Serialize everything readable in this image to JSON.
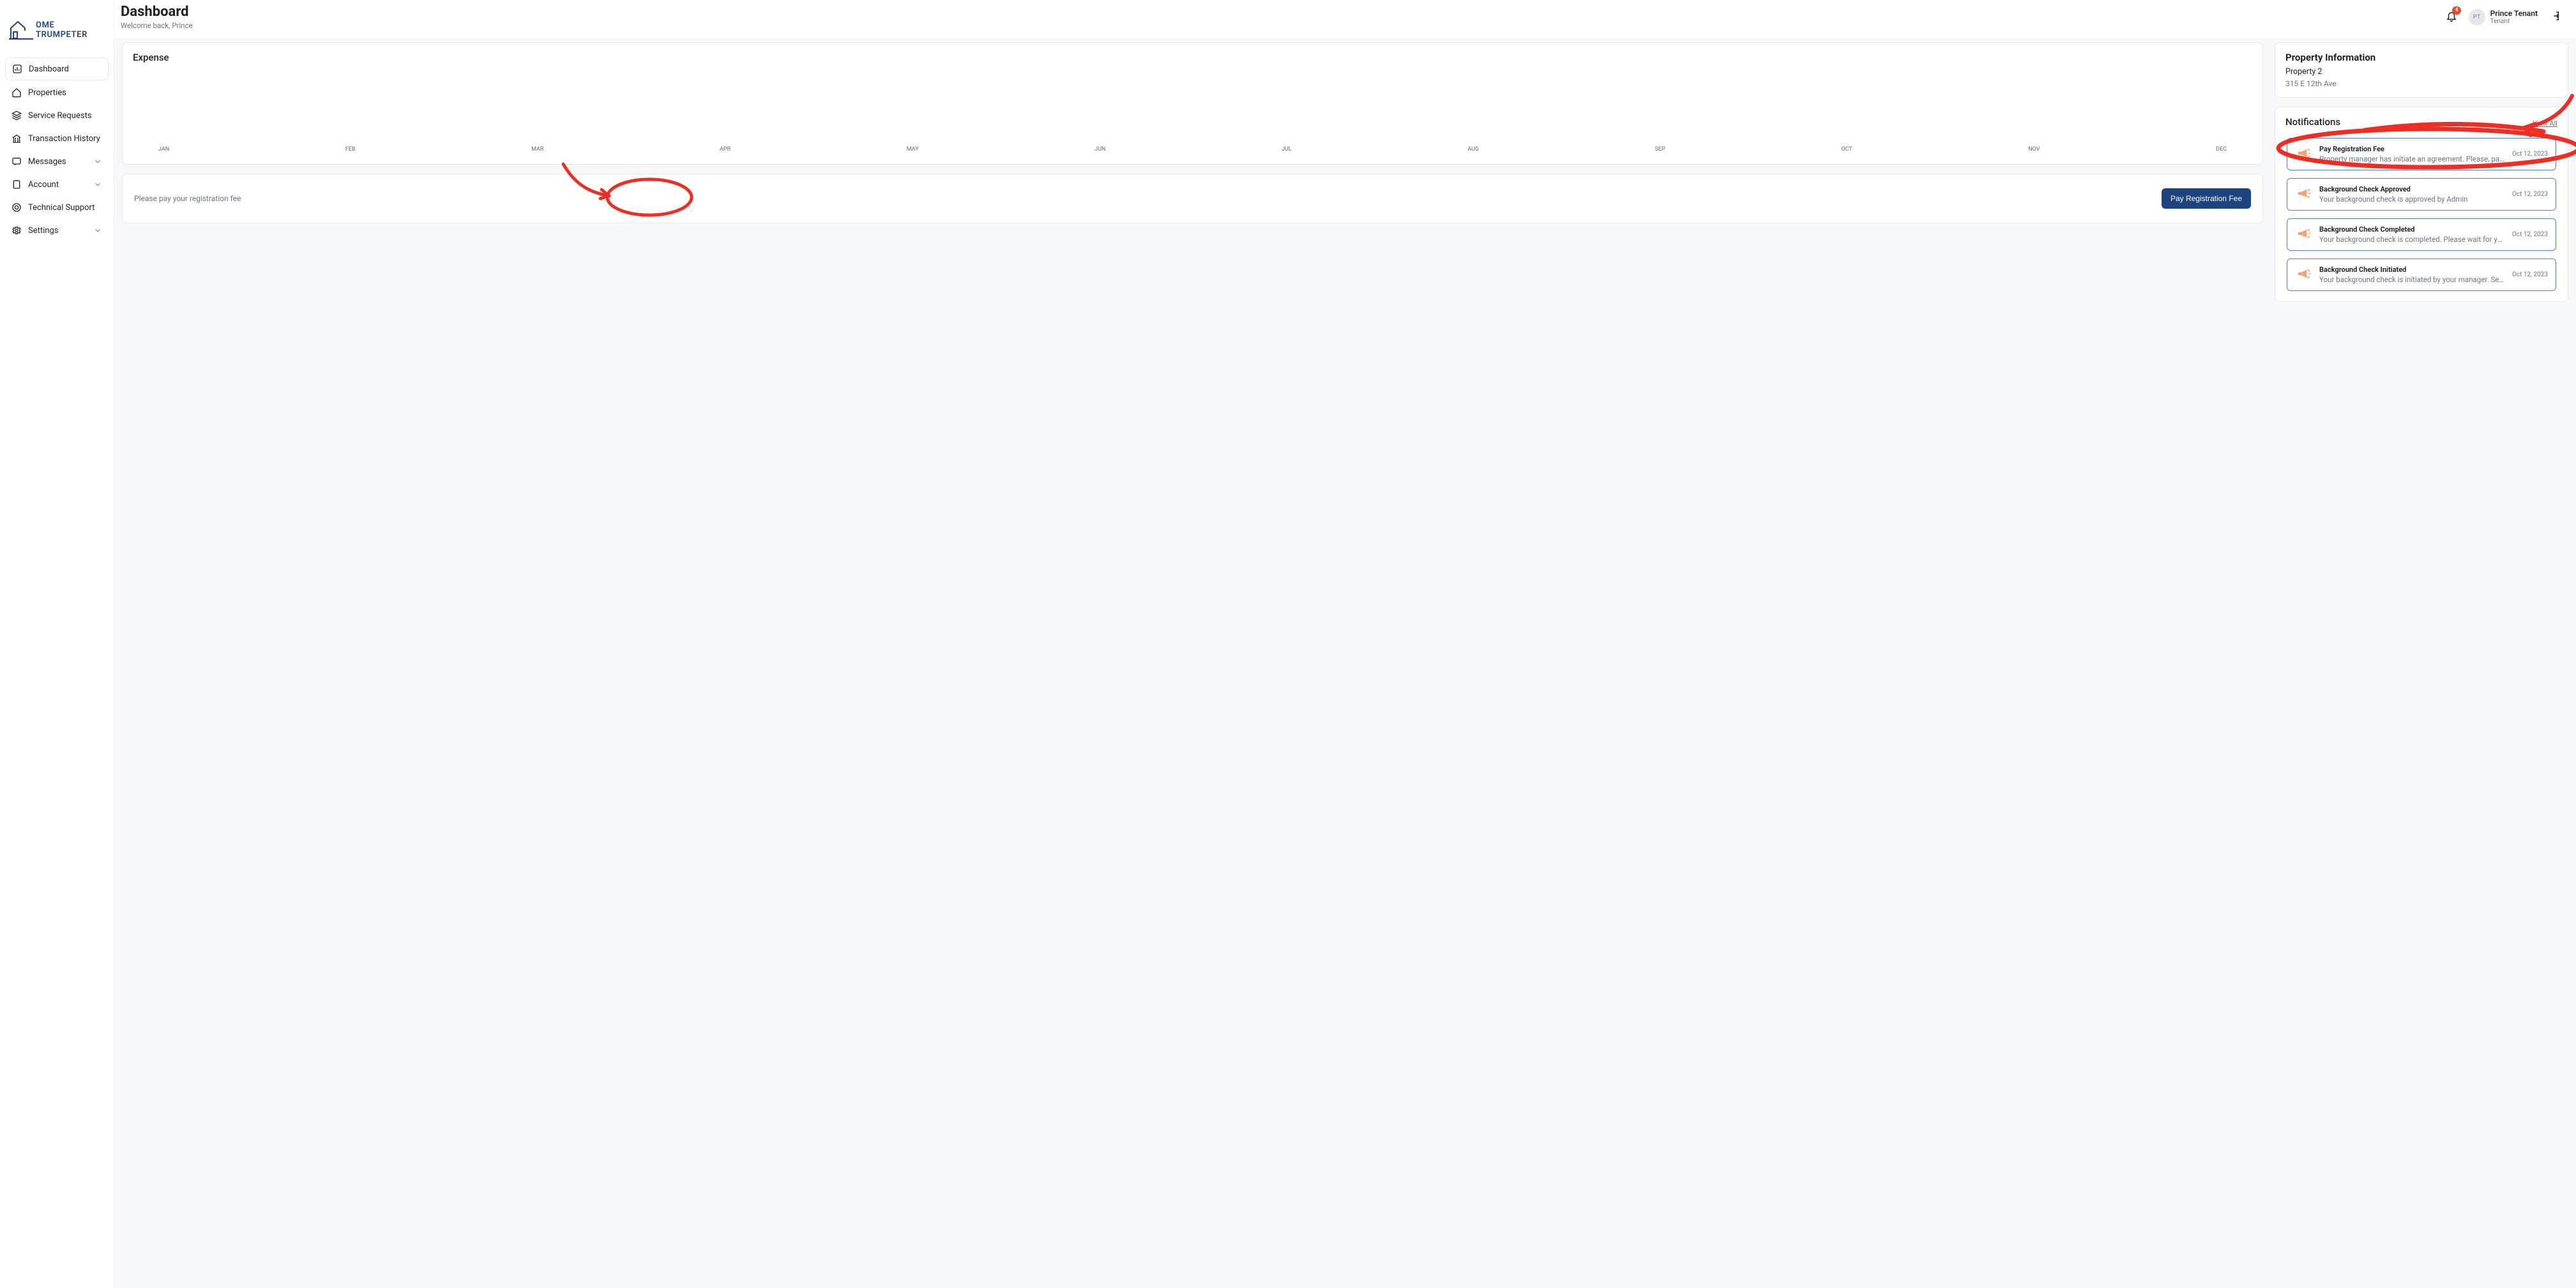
{
  "brand": "OME TRUMPETER",
  "sidebar": {
    "items": [
      {
        "label": "Dashboard",
        "active": true
      },
      {
        "label": "Properties"
      },
      {
        "label": "Service Requests"
      },
      {
        "label": "Transaction History"
      },
      {
        "label": "Messages",
        "expandable": true
      },
      {
        "label": "Account",
        "expandable": true
      },
      {
        "label": "Technical Support"
      },
      {
        "label": "Settings",
        "expandable": true
      }
    ]
  },
  "header": {
    "title": "Dashboard",
    "subtitle": "Welcome back, Prince",
    "badge_count": "4",
    "user_name": "Prince Tenant",
    "user_role": "Tenant",
    "user_initials": "PT"
  },
  "expense": {
    "title": "Expense",
    "months": [
      "JAN",
      "FEB",
      "MAR",
      "APR",
      "MAY",
      "JUN",
      "JUL",
      "AUG",
      "SEP",
      "OCT",
      "NOV",
      "DEC"
    ]
  },
  "pay_fee": {
    "message": "Please pay your registration fee",
    "button": "Pay Registration Fee"
  },
  "property_info": {
    "heading": "Property Information",
    "name": "Property 2",
    "address": "315 E 12th Ave"
  },
  "notifications": {
    "heading": "Notifications",
    "view_all": "View All",
    "items": [
      {
        "title": "Pay Registration Fee",
        "desc": "Property manager has initiate an agreement. Please, pay your registration fe...",
        "date": "Oct 12, 2023"
      },
      {
        "title": "Background Check Approved",
        "desc": "Your background check is approved by Admin",
        "date": "Oct 12, 2023"
      },
      {
        "title": "Background Check Completed",
        "desc": "Your background check is completed. Please wait for your manager approval.",
        "date": "Oct 12, 2023"
      },
      {
        "title": "Background Check Initiated",
        "desc": "Your background check is initiated by your manager. See your email for furt...",
        "date": "Oct 12, 2023"
      }
    ]
  },
  "chart_data": {
    "type": "bar",
    "categories": [
      "JAN",
      "FEB",
      "MAR",
      "APR",
      "MAY",
      "JUN",
      "JUL",
      "AUG",
      "SEP",
      "OCT",
      "NOV",
      "DEC"
    ],
    "values": [
      0,
      0,
      0,
      0,
      0,
      0,
      0,
      0,
      0,
      0,
      0,
      0
    ],
    "title": "Expense",
    "xlabel": "",
    "ylabel": "",
    "ylim": [
      0,
      100
    ]
  }
}
